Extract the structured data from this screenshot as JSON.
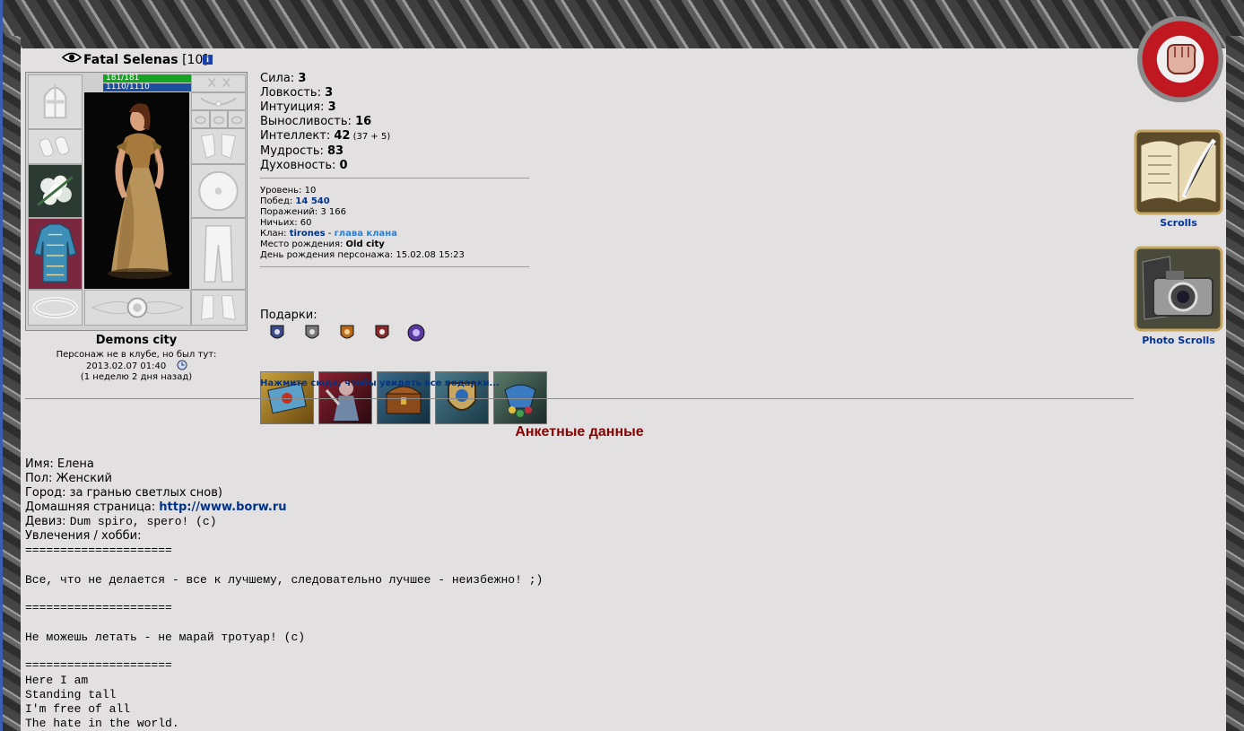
{
  "character": {
    "name": "Fatal Selenas",
    "level": "[10]",
    "hp": "181/181",
    "mana": "1110/1110",
    "city": "Demons city",
    "status_line": "Персонаж не в клубе, но был тут:",
    "last_seen": "2013.02.07 01:40",
    "last_seen_ago": "(1 неделю 2 дня назад)"
  },
  "stats": [
    {
      "label": "Сила: ",
      "value": "3",
      "extra": ""
    },
    {
      "label": "Ловкость: ",
      "value": "3",
      "extra": ""
    },
    {
      "label": "Интуиция: ",
      "value": "3",
      "extra": ""
    },
    {
      "label": "Выносливость: ",
      "value": "16",
      "extra": ""
    },
    {
      "label": "Интеллект: ",
      "value": "42",
      "extra": " (37 + 5)"
    },
    {
      "label": "Мудрость: ",
      "value": "83",
      "extra": ""
    },
    {
      "label": "Духовность: ",
      "value": "0",
      "extra": ""
    }
  ],
  "info": {
    "level_label": "Уровень: ",
    "level_value": "10",
    "wins_label": "Побед: ",
    "wins_value": "14 540",
    "losses_label": "Поражений: ",
    "losses_value": "3 166",
    "draws_label": "Ничьих: ",
    "draws_value": "60",
    "clan_label": "Клан: ",
    "clan_name": "tirones",
    "clan_sep": " - ",
    "clan_role": "глава клана",
    "birthplace_label": "Место рождения: ",
    "birthplace_value": "Old city",
    "birthday_label": "День рождения персонажа: ",
    "birthday_value": "15.02.08 15:23"
  },
  "gifts": {
    "title": "Подарки:",
    "link": "Нажмите сюда, чтобы увидеть все подарки..."
  },
  "sidebar": {
    "scrolls_label": "Scrolls",
    "photo_scrolls_label": "Photo Scrolls"
  },
  "profile": {
    "heading": "Анкетные данные",
    "name_line": "Имя: Елена",
    "gender_line": "Пол: Женский",
    "city_line": "Город: за гранью светлых снов)",
    "homepage_label": "Домашняя страница: ",
    "homepage_url": "http://www.borw.ru",
    "motto_label": "Девиз: ",
    "motto_value": "Dum spiro, spero! (c)",
    "hobby_label": "Увлечения / хобби:",
    "sep1": "=====================",
    "quote1": "Все, что не делается - все к лучшему, следовательно лучшее - неизбежно! ;)",
    "sep2": "=====================",
    "quote2": "Не можешь летать - не марай тротуар! (c)",
    "sep3": "=====================",
    "lyric1": "Here I am",
    "lyric2": "Standing tall",
    "lyric3": "I'm free of all",
    "lyric4": "The hate in the world."
  },
  "colors": {
    "hp_bar": "#17a323",
    "mana_bar": "#1c4f9e",
    "heading": "#8b0000",
    "link": "#003388",
    "clan_role": "#2f7fd0",
    "content_bg": "#e2e0e0"
  },
  "icons": [
    "eye-icon",
    "info-icon",
    "clock-icon",
    "fist-medallion-icon",
    "scroll-book-icon",
    "photo-camera-icon"
  ]
}
